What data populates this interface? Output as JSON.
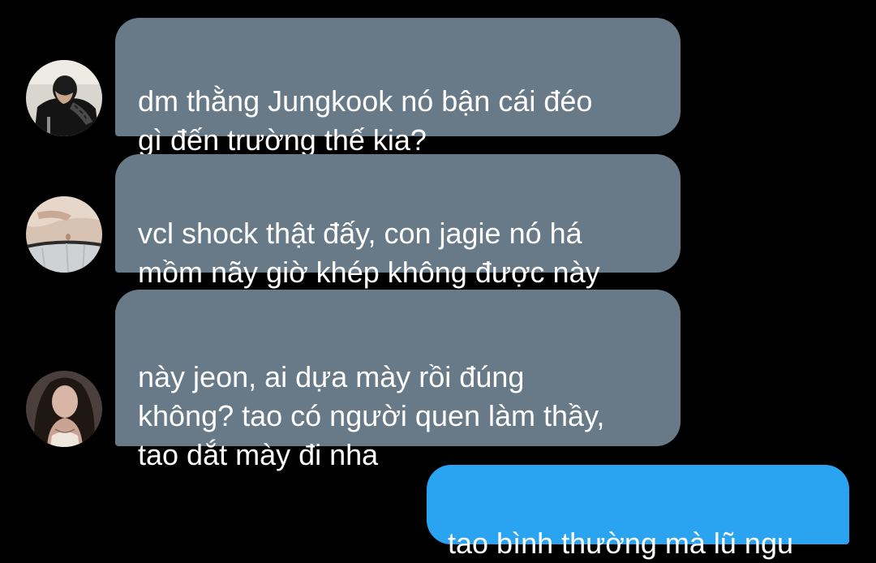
{
  "thread": {
    "messages": [
      {
        "direction": "incoming",
        "avatar_icon": "avatar-boy-with-tattoo",
        "text": "dm thằng Jungkook nó bận cái đéo\ngì đến trường thế kia?"
      },
      {
        "direction": "incoming",
        "avatar_icon": "avatar-waist-photo",
        "text": "vcl shock thật đấy, con jagie nó há\nmồm nãy giờ khép không được này"
      },
      {
        "direction": "incoming",
        "avatar_icon": "avatar-girl-portrait",
        "text": "này jeon, ai dựa mày rồi đúng\nkhông? tao có người quen làm thầy,\ntao dắt mày đi nha"
      },
      {
        "direction": "outgoing",
        "text": "tao bình thường mà lũ ngu"
      }
    ]
  },
  "colors": {
    "background": "#000000",
    "incoming_bubble": "#687987",
    "outgoing_bubble": "#2aa3f0",
    "text": "#ffffff"
  }
}
